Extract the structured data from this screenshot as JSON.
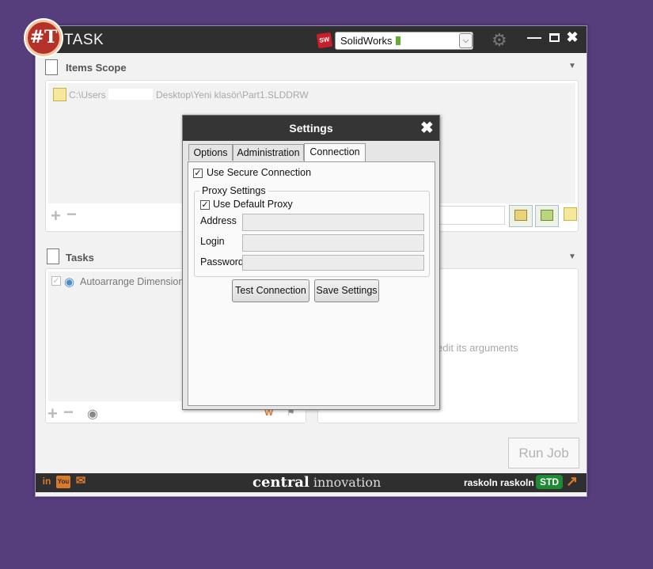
{
  "app": {
    "title": "TASK",
    "logo_text": "#T",
    "cad_selected": "SolidWorks",
    "cad_icon_label": "SW"
  },
  "items_scope": {
    "heading": "Items Scope",
    "file_prefix": "C:\\Users",
    "file_suffix": "Desktop\\Yeni klasör\\Part1.SLDDRW"
  },
  "tasks": {
    "heading": "Tasks",
    "items": [
      {
        "label": "Autoarrange Dimensions"
      }
    ],
    "hint_fragment": "edit its arguments"
  },
  "run_job_label": "Run Job",
  "footer": {
    "social": [
      "in",
      "You",
      "✉"
    ],
    "brand_a": "ce",
    "brand_b": "ntral",
    "brand_c": " innovation",
    "user": "raskoln raskoln",
    "license": "STD"
  },
  "settings": {
    "title": "Settings",
    "tabs": [
      "Options",
      "Administration",
      "Connection"
    ],
    "active_tab": "Connection",
    "use_secure_connection": {
      "label": "Use Secure Connection",
      "checked": true
    },
    "proxy": {
      "legend": "Proxy Settings",
      "use_default": {
        "label": "Use Default Proxy",
        "checked": true
      },
      "address_label": "Address",
      "login_label": "Login",
      "password_label": "Password",
      "address_value": "",
      "login_value": "",
      "password_value": ""
    },
    "test_button": "Test Connection",
    "save_button": "Save Settings"
  },
  "colors": {
    "background": "#563e7c",
    "titlebar": "#2f2f2f",
    "accent_orange": "#d97a2b",
    "license_green": "#1e8a34"
  }
}
